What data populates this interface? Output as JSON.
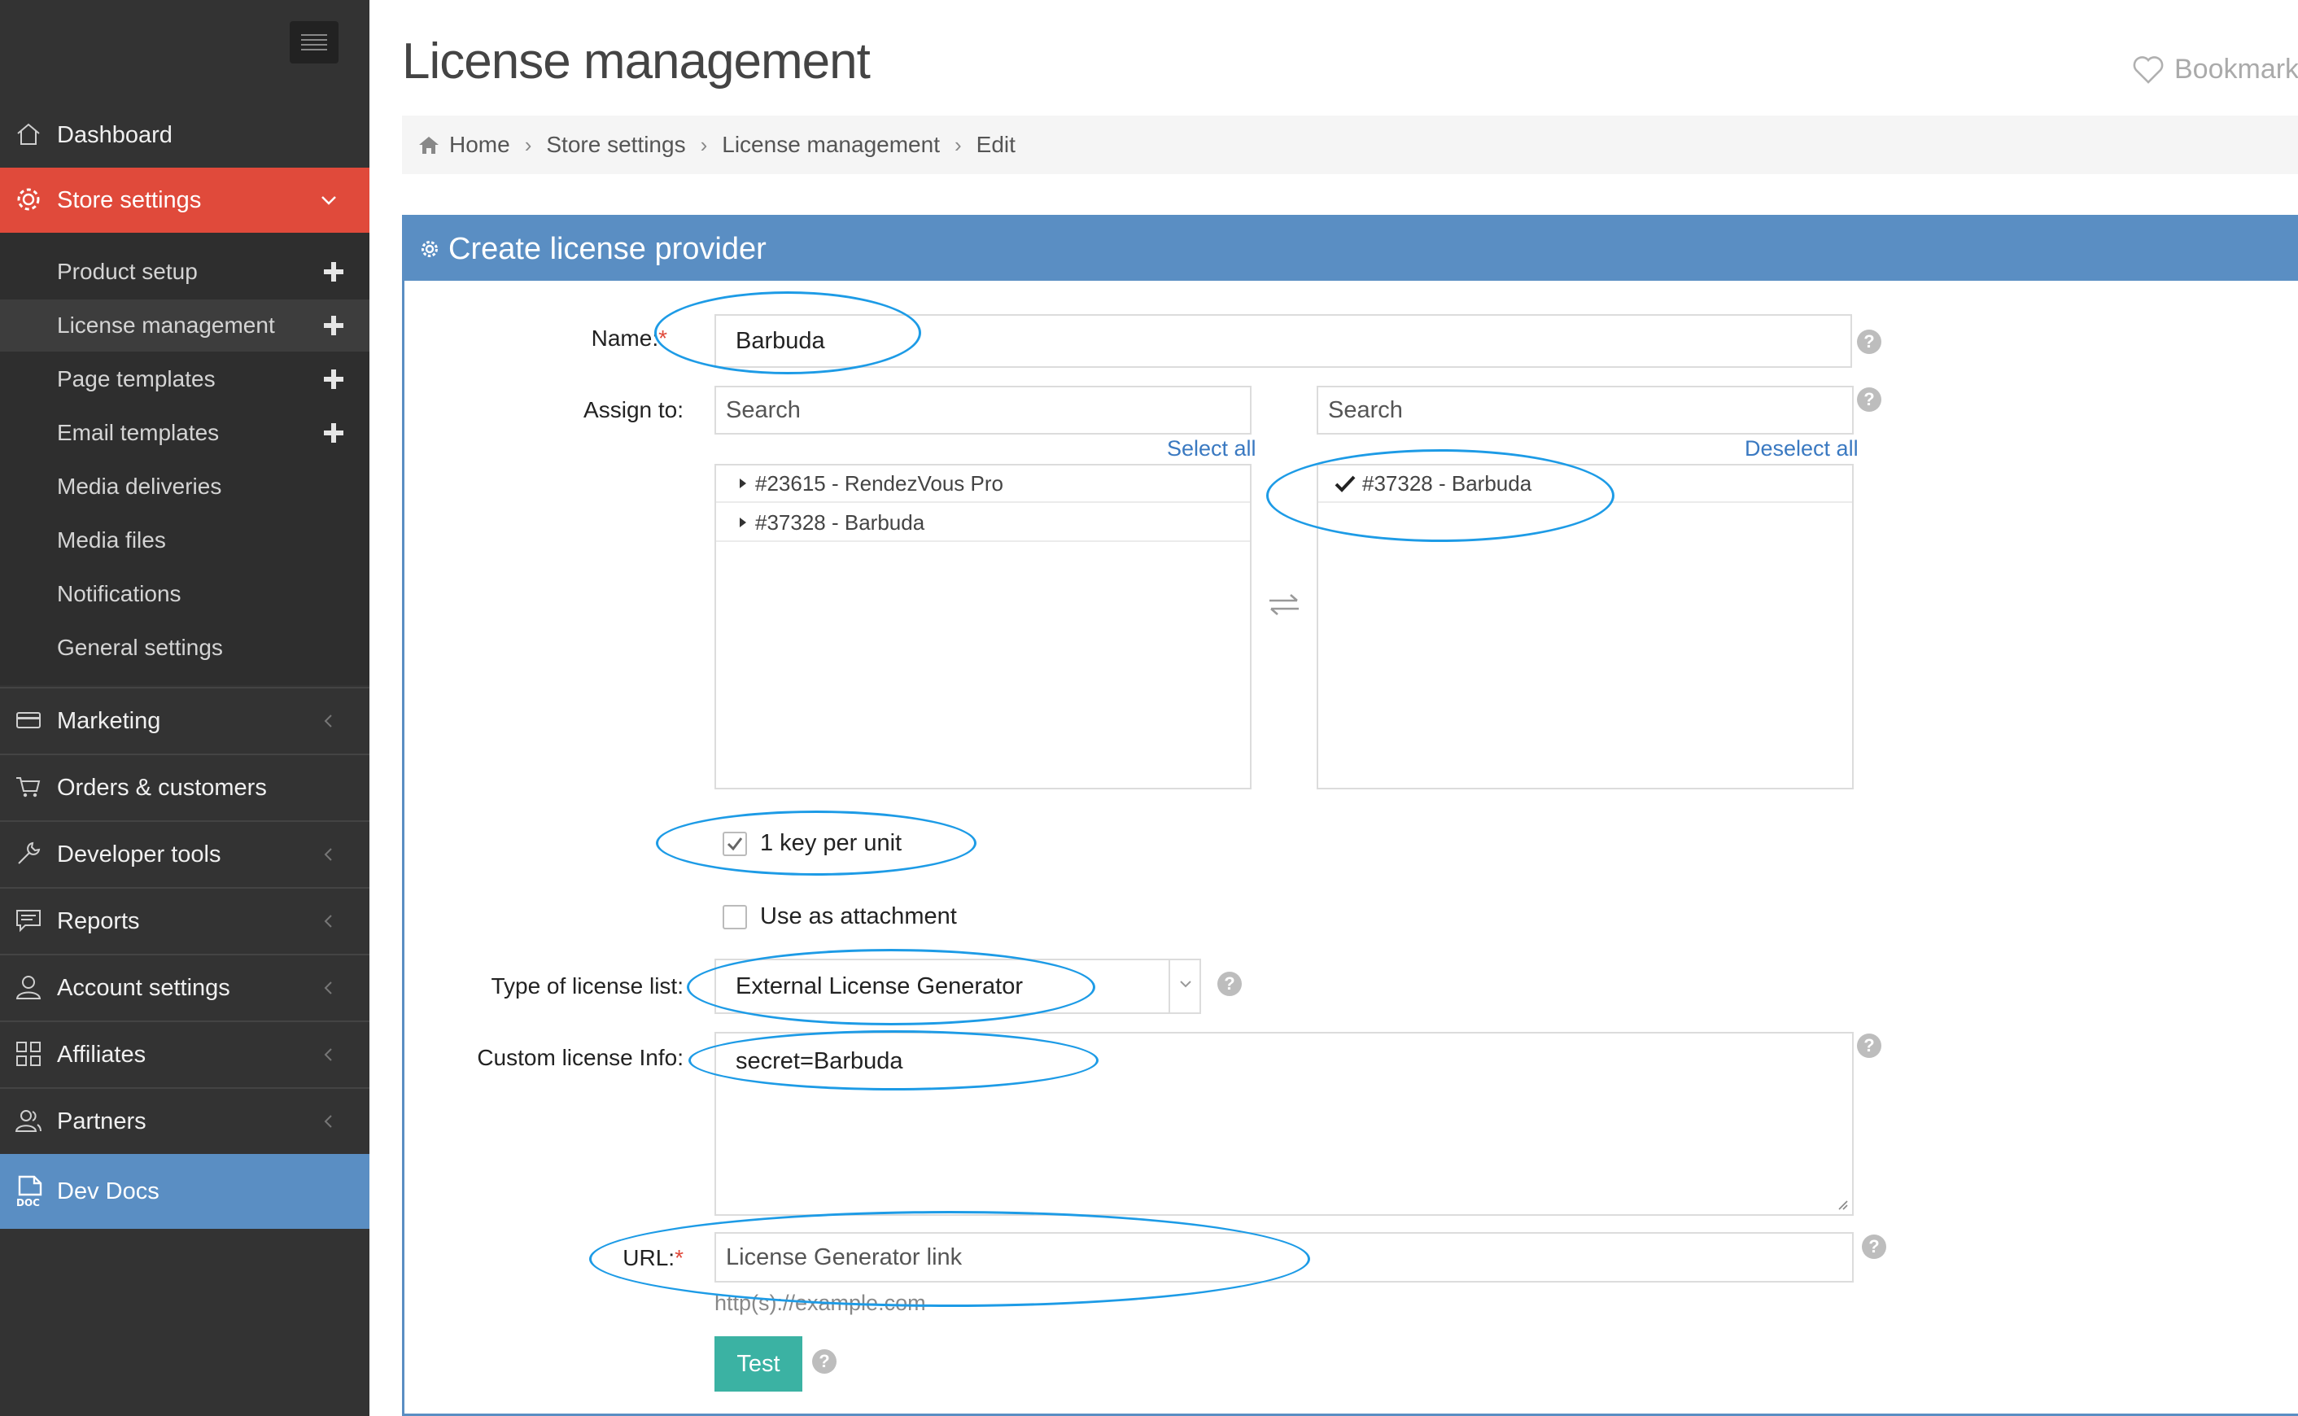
{
  "sidebar": {
    "items": [
      {
        "label": "Dashboard",
        "icon": "home-icon"
      },
      {
        "label": "Store settings",
        "icon": "gear-icon"
      },
      {
        "label": "Marketing",
        "icon": "card-icon"
      },
      {
        "label": "Orders & customers",
        "icon": "cart-icon"
      },
      {
        "label": "Developer tools",
        "icon": "wrench-icon"
      },
      {
        "label": "Reports",
        "icon": "chat-icon"
      },
      {
        "label": "Account settings",
        "icon": "user-icon"
      },
      {
        "label": "Affiliates",
        "icon": "grid-icon"
      },
      {
        "label": "Partners",
        "icon": "users-icon"
      },
      {
        "label": "Dev Docs",
        "icon": "doc-icon"
      }
    ],
    "submenu": [
      {
        "label": "Product setup"
      },
      {
        "label": "License management"
      },
      {
        "label": "Page templates"
      },
      {
        "label": "Email templates"
      },
      {
        "label": "Media deliveries"
      },
      {
        "label": "Media files"
      },
      {
        "label": "Notifications"
      },
      {
        "label": "General settings"
      }
    ]
  },
  "header": {
    "title": "License management",
    "bookmark": "Bookmark"
  },
  "breadcrumb": [
    "Home",
    "Store settings",
    "License management",
    "Edit"
  ],
  "panel": {
    "title": "Create license provider",
    "name_label": "Name:",
    "name_value": "Barbuda",
    "assign_label": "Assign to:",
    "search_placeholder_left": "Search",
    "search_placeholder_right": "Search",
    "select_all": "Select all",
    "deselect_all": "Deselect all",
    "available_items": [
      "#23615 - RendezVous Pro",
      "#37328 - Barbuda"
    ],
    "selected_items": [
      "#37328 - Barbuda"
    ],
    "key_per_unit": "1 key per unit",
    "key_per_unit_checked": true,
    "use_as_attachment": "Use as attachment",
    "use_as_attachment_checked": false,
    "type_label": "Type of license list:",
    "type_value": "External License Generator",
    "custom_label": "Custom license Info:",
    "custom_value": "secret=Barbuda",
    "url_label": "URL:",
    "url_placeholder": "License Generator link",
    "url_hint": "http(s)://example.com",
    "test_button": "Test"
  },
  "colors": {
    "sidebar_bg": "#333333",
    "active_red": "#e04a3b",
    "panel_blue": "#5a8ec3",
    "test_teal": "#3bb2a3",
    "annotation_blue": "#1d9be6"
  }
}
